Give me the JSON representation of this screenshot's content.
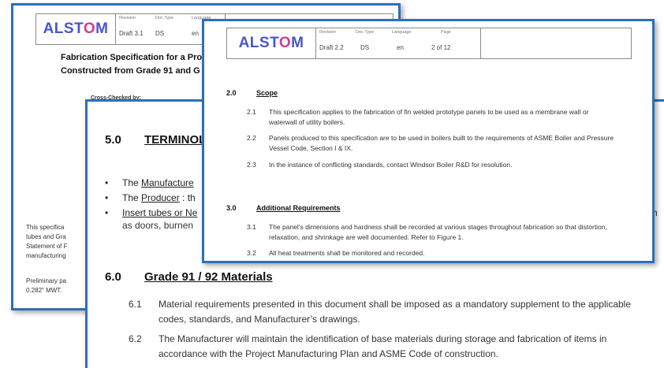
{
  "logo_text_pre": "ALST",
  "logo_text_o": "O",
  "logo_text_post": "M",
  "header_labels": {
    "revision": "Revision",
    "doc_type": "Doc Type",
    "language": "Language",
    "page": "Page"
  },
  "back_page": {
    "revision": "Draft 3.1",
    "doc_type": "DS",
    "language": "en",
    "title_line1": "Fabrication Specification for a Proj",
    "title_line2": "Constructed from Grade 91 and G",
    "cross_checked": "Cross-Checked by:",
    "para1": [
      "This specifica",
      "tubes and Gra",
      "Statement of F",
      "manufacturing"
    ],
    "para2": [
      "Preliminary pa",
      "0.282\" MWT."
    ]
  },
  "middle_page": {
    "sec5_num": "5.0",
    "sec5_title": "TERMINOL",
    "bullets": [
      {
        "pre": "The ",
        "link": "Manufacture",
        "post": ""
      },
      {
        "pre": "The ",
        "link": "Producer",
        "post": " : th"
      },
      {
        "pre": "",
        "link": "Insert tubes or Ne",
        "post": ""
      }
    ],
    "bullet3_cont": "as doors, burnen",
    "side_fragment": "ch",
    "sec6_num": "6.0",
    "sec6_title": "Grade 91 / 92 Materials",
    "items": [
      {
        "num": "6.1",
        "text": "Material requirements presented in this document shall be imposed as a mandatory supplement to the applicable codes, standards, and Manufacturer’s drawings."
      },
      {
        "num": "6.2",
        "text": "The Manufacturer will maintain the identification of base materials during storage and fabrication of items in accordance with the Project Manufacturing Plan and ASME Code of construction."
      }
    ]
  },
  "front_page": {
    "revision": "Draft 2.2",
    "doc_type": "DS",
    "language": "en",
    "page": "2 of 12",
    "sec2_num": "2.0",
    "sec2_title": "Scope",
    "scope_items": [
      {
        "num": "2.1",
        "text": "This specification applies to the fabrication of fin welded prototype panels to be used as a membrane wall or waterwall of utility boilers."
      },
      {
        "num": "2.2",
        "text": "Panels produced to this specification are to be used in boilers built to the requirements of ASME Boiler and Pressure Vessel Code, Section I & IX."
      },
      {
        "num": "2.3",
        "text": "In the instance of conflicting standards, contact Windsor Boiler R&D for resolution."
      }
    ],
    "sec3_num": "3.0",
    "sec3_title": "Additional Requirements",
    "add_items": [
      {
        "num": "3.1",
        "text": "The panel’s dimensions and hardness shall be recorded at various stages throughout fabrication so that distortion, relaxation, and shrinkage are well documented.  Refer to Figure 1."
      },
      {
        "num": "3.2",
        "text": "All heat treatments shall be monitored and recorded."
      }
    ]
  }
}
